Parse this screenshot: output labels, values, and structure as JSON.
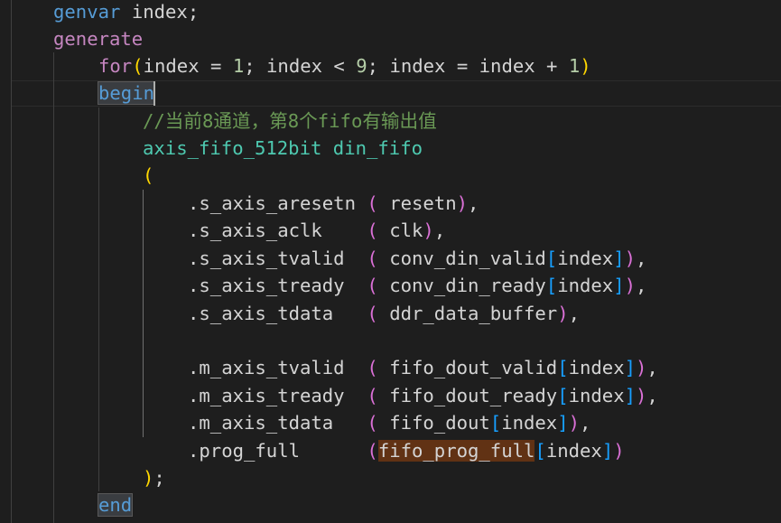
{
  "editor": {
    "language": "verilog",
    "theme": "dark",
    "lines": [
      [
        {
          "t": "genvar",
          "c": "kw"
        },
        {
          "t": " "
        },
        {
          "t": "index",
          "c": "pl"
        },
        {
          "t": ";",
          "c": "pl"
        }
      ],
      [
        {
          "t": "generate",
          "c": "ctl"
        }
      ],
      [
        {
          "t": "for",
          "c": "ctl"
        },
        {
          "t": "(",
          "c": "br1"
        },
        {
          "t": "index",
          "c": "pl"
        },
        {
          "t": " = ",
          "c": "pl"
        },
        {
          "t": "1",
          "c": "num"
        },
        {
          "t": "; ",
          "c": "pl"
        },
        {
          "t": "index",
          "c": "pl"
        },
        {
          "t": " < ",
          "c": "pl"
        },
        {
          "t": "9",
          "c": "num"
        },
        {
          "t": "; ",
          "c": "pl"
        },
        {
          "t": "index",
          "c": "pl"
        },
        {
          "t": " = ",
          "c": "pl"
        },
        {
          "t": "index",
          "c": "pl"
        },
        {
          "t": " + ",
          "c": "pl"
        },
        {
          "t": "1",
          "c": "num"
        },
        {
          "t": ")",
          "c": "br1"
        }
      ],
      [
        {
          "t": "begin",
          "c": "kw hl-begin"
        }
      ],
      [
        {
          "t": "//当前8通道，第8个fifo有输出值",
          "c": "cm"
        }
      ],
      [
        {
          "t": "axis_fifo_512bit",
          "c": "ty"
        },
        {
          "t": " "
        },
        {
          "t": "din_fifo",
          "c": "ty"
        }
      ],
      [
        {
          "t": "(",
          "c": "br1"
        }
      ],
      [
        {
          "t": ".s_axis_aresetn",
          "c": "pl"
        },
        {
          "t": " "
        },
        {
          "t": "(",
          "c": "br2"
        },
        {
          "t": " resetn",
          "c": "pl"
        },
        {
          "t": ")",
          "c": "br2"
        },
        {
          "t": ",",
          "c": "pl"
        }
      ],
      [
        {
          "t": ".s_axis_aclk",
          "c": "pl"
        },
        {
          "t": "    "
        },
        {
          "t": "(",
          "c": "br2"
        },
        {
          "t": " clk",
          "c": "pl"
        },
        {
          "t": ")",
          "c": "br2"
        },
        {
          "t": ",",
          "c": "pl"
        }
      ],
      [
        {
          "t": ".s_axis_tvalid",
          "c": "pl"
        },
        {
          "t": "  "
        },
        {
          "t": "(",
          "c": "br2"
        },
        {
          "t": " conv_din_valid",
          "c": "pl"
        },
        {
          "t": "[",
          "c": "br3"
        },
        {
          "t": "index",
          "c": "pl"
        },
        {
          "t": "]",
          "c": "br3"
        },
        {
          "t": ")",
          "c": "br2"
        },
        {
          "t": ",",
          "c": "pl"
        }
      ],
      [
        {
          "t": ".s_axis_tready",
          "c": "pl"
        },
        {
          "t": "  "
        },
        {
          "t": "(",
          "c": "br2"
        },
        {
          "t": " conv_din_ready",
          "c": "pl"
        },
        {
          "t": "[",
          "c": "br3"
        },
        {
          "t": "index",
          "c": "pl"
        },
        {
          "t": "]",
          "c": "br3"
        },
        {
          "t": ")",
          "c": "br2"
        },
        {
          "t": ",",
          "c": "pl"
        }
      ],
      [
        {
          "t": ".s_axis_tdata",
          "c": "pl"
        },
        {
          "t": "   "
        },
        {
          "t": "(",
          "c": "br2"
        },
        {
          "t": " ddr_data_buffer",
          "c": "pl"
        },
        {
          "t": ")",
          "c": "br2"
        },
        {
          "t": ",",
          "c": "pl"
        }
      ],
      [],
      [
        {
          "t": ".m_axis_tvalid",
          "c": "pl"
        },
        {
          "t": "  "
        },
        {
          "t": "(",
          "c": "br2"
        },
        {
          "t": " fifo_dout_valid",
          "c": "pl"
        },
        {
          "t": "[",
          "c": "br3"
        },
        {
          "t": "index",
          "c": "pl"
        },
        {
          "t": "]",
          "c": "br3"
        },
        {
          "t": ")",
          "c": "br2"
        },
        {
          "t": ",",
          "c": "pl"
        }
      ],
      [
        {
          "t": ".m_axis_tready",
          "c": "pl"
        },
        {
          "t": "  "
        },
        {
          "t": "(",
          "c": "br2"
        },
        {
          "t": " fifo_dout_ready",
          "c": "pl"
        },
        {
          "t": "[",
          "c": "br3"
        },
        {
          "t": "index",
          "c": "pl"
        },
        {
          "t": "]",
          "c": "br3"
        },
        {
          "t": ")",
          "c": "br2"
        },
        {
          "t": ",",
          "c": "pl"
        }
      ],
      [
        {
          "t": ".m_axis_tdata",
          "c": "pl"
        },
        {
          "t": "   "
        },
        {
          "t": "(",
          "c": "br2"
        },
        {
          "t": " fifo_dout",
          "c": "pl"
        },
        {
          "t": "[",
          "c": "br3"
        },
        {
          "t": "index",
          "c": "pl"
        },
        {
          "t": "]",
          "c": "br3"
        },
        {
          "t": ")",
          "c": "br2"
        },
        {
          "t": ",",
          "c": "pl"
        }
      ],
      [
        {
          "t": ".prog_full",
          "c": "pl"
        },
        {
          "t": "      "
        },
        {
          "t": "(",
          "c": "br2"
        },
        {
          "t": "fifo_prog_full",
          "c": "pl hl-sel"
        },
        {
          "t": "[",
          "c": "br3"
        },
        {
          "t": "index",
          "c": "pl"
        },
        {
          "t": "]",
          "c": "br3"
        },
        {
          "t": ")",
          "c": "br2"
        }
      ],
      [
        {
          "t": ")",
          "c": "br1"
        },
        {
          "t": ";",
          "c": "pl"
        }
      ],
      [
        {
          "t": "end",
          "c": "kw hl-end"
        }
      ]
    ]
  }
}
